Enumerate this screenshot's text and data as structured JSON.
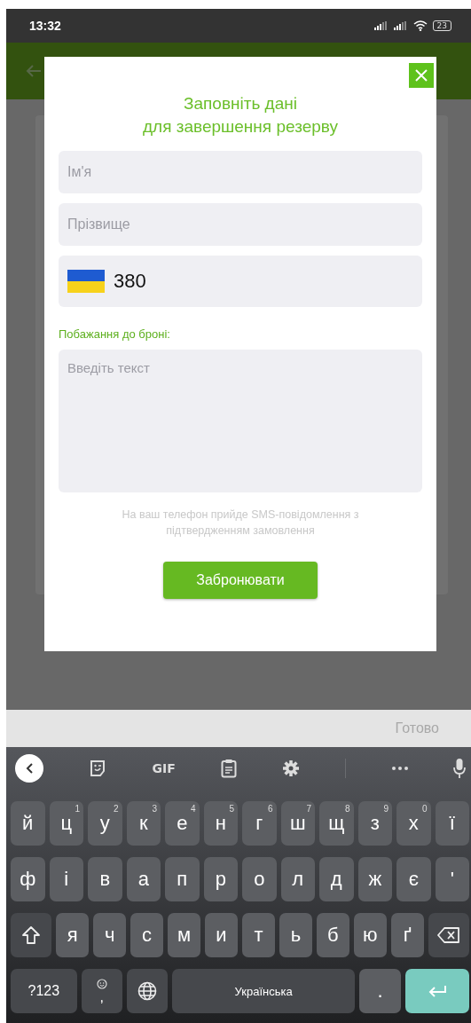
{
  "status_bar": {
    "time": "13:32",
    "battery": "23"
  },
  "dialog": {
    "title_lines": [
      "Заповніть дані",
      "для завершення резерву"
    ],
    "fields": [
      {
        "kind": "text",
        "placeholder": "Ім'я"
      },
      {
        "kind": "text",
        "placeholder": "Прізвище"
      },
      {
        "kind": "phone",
        "value": "380"
      }
    ],
    "wishes_label": "Побажання до броні:",
    "wishes_placeholder": "Введіть текст",
    "note": "На ваш телефон прийде SMS-повідомлення з підтвердженням замовлення",
    "submit": "Забронювати"
  },
  "suggestion_bar": {
    "done": "Готово"
  },
  "keyboard_toolbar": [
    {
      "kind": "back"
    },
    {
      "kind": "sticker"
    },
    {
      "kind": "gif",
      "label": "GIF"
    },
    {
      "kind": "clipboard"
    },
    {
      "kind": "settings"
    },
    {
      "kind": "divider"
    },
    {
      "kind": "more"
    },
    {
      "kind": "mic"
    }
  ],
  "keyboard": [
    [
      {
        "kind": "letter",
        "label": "й"
      },
      {
        "kind": "letter",
        "label": "ц",
        "hint": "1"
      },
      {
        "kind": "letter",
        "label": "у",
        "hint": "2"
      },
      {
        "kind": "letter",
        "label": "к",
        "hint": "3"
      },
      {
        "kind": "letter",
        "label": "е",
        "hint": "4"
      },
      {
        "kind": "letter",
        "label": "н",
        "hint": "5"
      },
      {
        "kind": "letter",
        "label": "г",
        "hint": "6"
      },
      {
        "kind": "letter",
        "label": "ш",
        "hint": "7"
      },
      {
        "kind": "letter",
        "label": "щ",
        "hint": "8"
      },
      {
        "kind": "letter",
        "label": "з",
        "hint": "9"
      },
      {
        "kind": "letter",
        "label": "х",
        "hint": "0"
      },
      {
        "kind": "letter",
        "label": "ї"
      }
    ],
    [
      {
        "kind": "letter",
        "label": "ф"
      },
      {
        "kind": "letter",
        "label": "і"
      },
      {
        "kind": "letter",
        "label": "в"
      },
      {
        "kind": "letter",
        "label": "а"
      },
      {
        "kind": "letter",
        "label": "п"
      },
      {
        "kind": "letter",
        "label": "р"
      },
      {
        "kind": "letter",
        "label": "о"
      },
      {
        "kind": "letter",
        "label": "л"
      },
      {
        "kind": "letter",
        "label": "д"
      },
      {
        "kind": "letter",
        "label": "ж"
      },
      {
        "kind": "letter",
        "label": "є"
      },
      {
        "kind": "letter",
        "label": "'"
      }
    ],
    [
      {
        "kind": "shift"
      },
      {
        "kind": "letter",
        "label": "я"
      },
      {
        "kind": "letter",
        "label": "ч"
      },
      {
        "kind": "letter",
        "label": "с"
      },
      {
        "kind": "letter",
        "label": "м"
      },
      {
        "kind": "letter",
        "label": "и"
      },
      {
        "kind": "letter",
        "label": "т"
      },
      {
        "kind": "letter",
        "label": "ь"
      },
      {
        "kind": "letter",
        "label": "б"
      },
      {
        "kind": "letter",
        "label": "ю"
      },
      {
        "kind": "letter",
        "label": "ґ"
      },
      {
        "kind": "backspace"
      }
    ],
    [
      {
        "kind": "symbols",
        "label": "?123"
      },
      {
        "kind": "emoji_comma",
        "label": ","
      },
      {
        "kind": "globe"
      },
      {
        "kind": "space",
        "label": "Українська"
      },
      {
        "kind": "letter",
        "label": "."
      },
      {
        "kind": "enter"
      }
    ]
  ]
}
